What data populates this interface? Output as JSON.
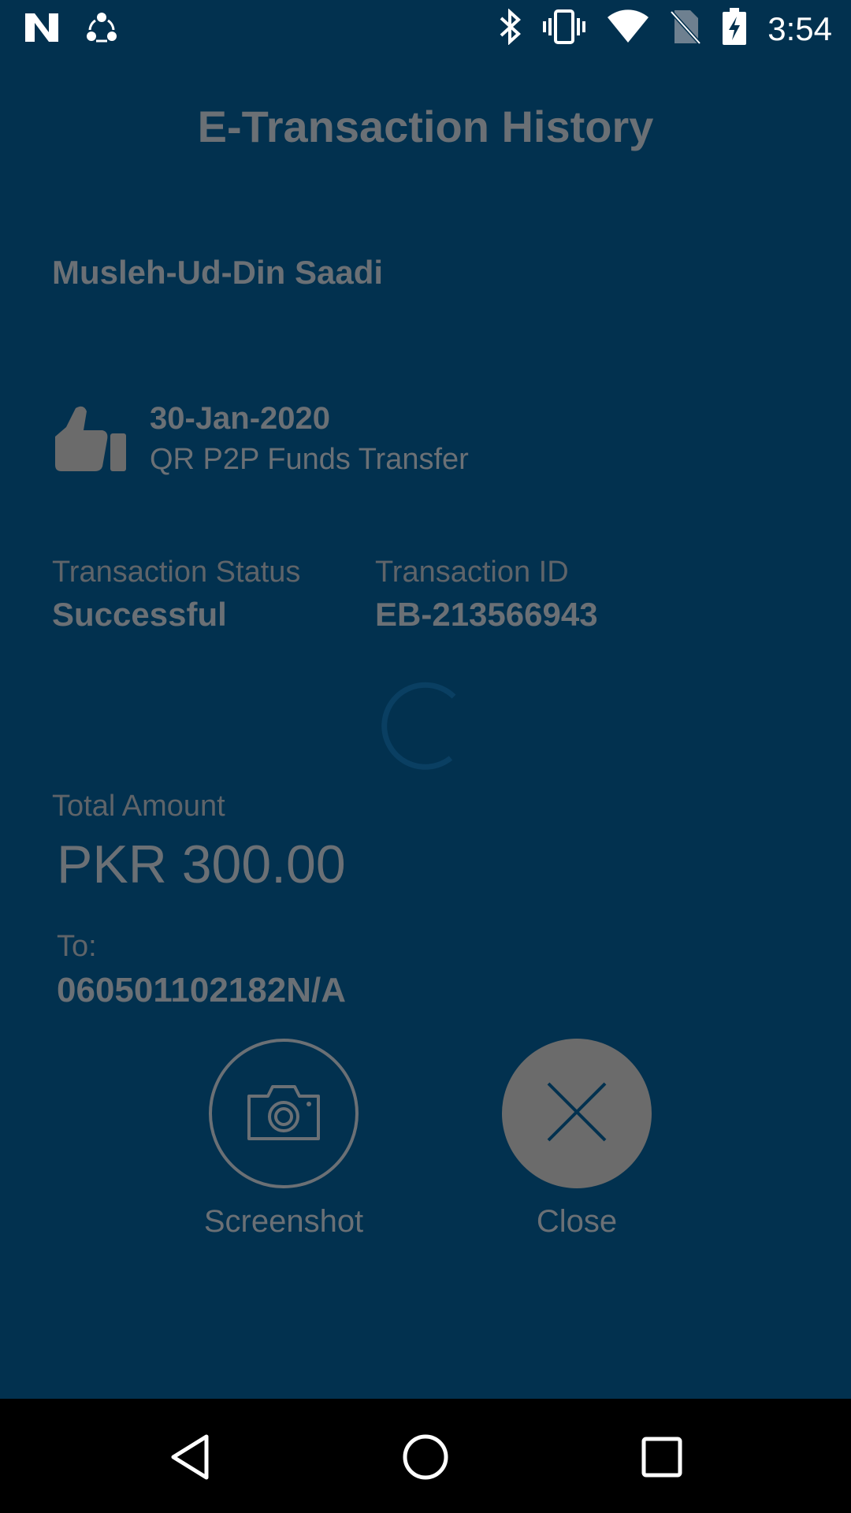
{
  "status_bar": {
    "time": "3:54",
    "left_icons": [
      "n-notification-icon",
      "share-sync-icon"
    ],
    "right_icons": [
      "bluetooth-icon",
      "vibrate-icon",
      "wifi-icon",
      "no-sim-icon",
      "battery-charging-icon"
    ]
  },
  "page": {
    "title": "E-Transaction History"
  },
  "customer": {
    "name": "Musleh-Ud-Din Saadi"
  },
  "transaction": {
    "icon": "thumbs-up-icon",
    "date": "30-Jan-2020",
    "type": "QR P2P Funds Transfer",
    "status_label": "Transaction Status",
    "status_value": "Successful",
    "id_label": "Transaction ID",
    "id_value": "EB-213566943",
    "amount_label": "Total Amount",
    "amount_value": "PKR 300.00",
    "to_label": "To:",
    "to_value": "060501102182N/A"
  },
  "actions": {
    "screenshot_label": "Screenshot",
    "close_label": "Close"
  },
  "colors": {
    "background": "#02314f",
    "text_dim": "#6b7075",
    "close_button": "#6b6b6b"
  }
}
